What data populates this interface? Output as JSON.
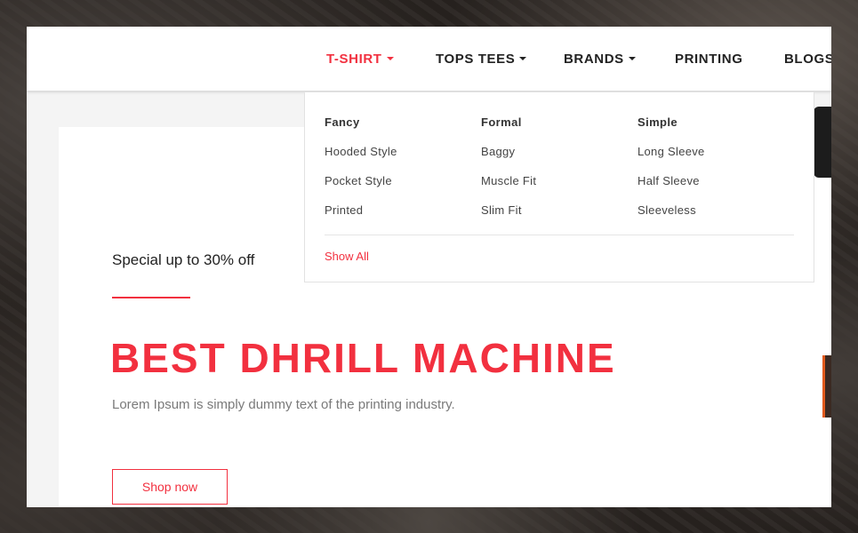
{
  "nav": {
    "items": [
      {
        "label": "T-SHIRT",
        "has_caret": true,
        "active": true
      },
      {
        "label": "TOPS TEES",
        "has_caret": true,
        "active": false
      },
      {
        "label": "BRANDS",
        "has_caret": true,
        "active": false
      },
      {
        "label": "PRINTING",
        "has_caret": false,
        "active": false
      },
      {
        "label": "BLOGS",
        "has_caret": false,
        "active": false
      }
    ]
  },
  "mega_menu": {
    "columns": [
      {
        "title": "Fancy",
        "links": [
          "Hooded Style",
          "Pocket Style",
          "Printed"
        ]
      },
      {
        "title": "Formal",
        "links": [
          "Baggy",
          "Muscle Fit",
          "Slim Fit"
        ]
      },
      {
        "title": "Simple",
        "links": [
          "Long Sleeve",
          "Half Sleeve",
          "Sleeveless"
        ]
      }
    ],
    "show_all": "Show All"
  },
  "hero": {
    "tagline": "Special up to 30% off",
    "headline": "BEST DHRILL MACHINE",
    "description": "Lorem Ipsum is simply dummy text of the printing  industry.",
    "button": "Shop now"
  },
  "colors": {
    "accent": "#f2303f",
    "text_dark": "#222222",
    "text_muted": "#7a7a7a"
  },
  "icons": {
    "dropdown": "caret-down-icon"
  }
}
